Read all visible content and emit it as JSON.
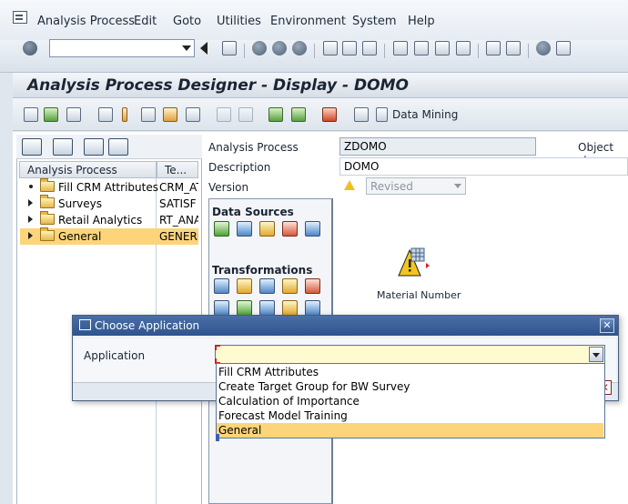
{
  "menubar": {
    "items": [
      "Analysis Process",
      "Edit",
      "Goto",
      "Utilities",
      "Environment",
      "System",
      "Help"
    ]
  },
  "command_field": {
    "value": ""
  },
  "title": "Analysis Process Designer - Display - DOMO",
  "app_toolbar": {
    "data_mining_label": "Data Mining"
  },
  "tree": {
    "columns": [
      "Analysis Process",
      "Te..."
    ],
    "rows": [
      {
        "label": "Fill CRM Attributes",
        "tech": "CRM_AT",
        "expandable": false,
        "selected": false
      },
      {
        "label": "Surveys",
        "tech": "SATISF",
        "expandable": true,
        "selected": false
      },
      {
        "label": "Retail Analytics",
        "tech": "RT_ANA",
        "expandable": true,
        "selected": false
      },
      {
        "label": "General",
        "tech": "GENERI",
        "expandable": true,
        "selected": true
      }
    ]
  },
  "form": {
    "analysis_process_label": "Analysis Process",
    "analysis_process_value": "ZDOMO",
    "object_status_label": "Object sta",
    "description_label": "Description",
    "description_value": "DOMO",
    "version_label": "Version",
    "version_value": "Revised"
  },
  "palette": {
    "data_sources_title": "Data Sources",
    "transformations_title": "Transformations"
  },
  "canvas": {
    "node_label": "Material Number"
  },
  "dialog": {
    "title": "Choose Application",
    "close_label": "✕",
    "application_label": "Application",
    "application_value": "",
    "options": [
      "Fill CRM Attributes",
      "Create Target Group for BW Survey",
      "Calculation of Importance",
      "Forecast Model Training",
      "General"
    ],
    "highlighted_option": "General",
    "cancel_label": "✕"
  },
  "colors": {
    "selection": "#fcd47a",
    "dialog_titlebar": "#2e5490",
    "input_required": "#fffbd0"
  }
}
